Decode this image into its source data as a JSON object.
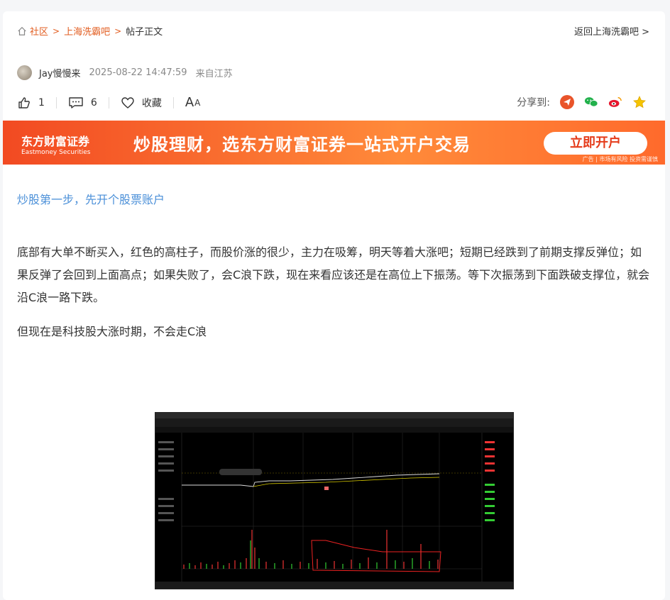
{
  "breadcrumb": {
    "items": [
      "社区",
      "上海洗霸吧",
      "帖子正文"
    ],
    "back_link": "返回上海洗霸吧"
  },
  "post": {
    "author": "Jay慢慢来",
    "time": "2025-08-22 14:47:59",
    "from": "来自江苏",
    "likes": "1",
    "comments": "6",
    "favorite_label": "收藏",
    "font_label": "A",
    "font_label_small": "A",
    "share_label": "分享到:"
  },
  "banner": {
    "logo_cn": "东方财富证券",
    "logo_en": "Eastmoney Securities",
    "slogan": "炒股理财，选东方财富证券一站式开户交易",
    "cta": "立即开户",
    "note": "广告 | 市场有风险 投资需谨慎"
  },
  "content": {
    "promo_link": "炒股第一步，先开个股票账户",
    "paragraph1": "底部有大单不断买入，红色的高柱子，而股价涨的很少，主力在吸筹，明天等着大涨吧；短期已经跌到了前期支撑反弹位；如果反弹了会回到上面高点；如果失败了，会C浪下跌，现在来看应该还是在高位上下振荡。等下次振荡到下面跌破支撑位，就会沿C浪一路下跌。",
    "paragraph2": "但现在是科技股大涨时期，不会走C浪"
  },
  "colors": {
    "accent": "#e25d20",
    "link": "#4a8fd8",
    "banner_start": "#f24a22",
    "banner_end": "#ff8a3a"
  },
  "icons": {
    "home": "home-icon",
    "like": "thumbs-up-icon",
    "comment": "comment-icon",
    "favorite": "heart-icon",
    "share_targets": [
      "telegram-icon",
      "wechat-icon",
      "weibo-icon",
      "star-icon"
    ]
  }
}
